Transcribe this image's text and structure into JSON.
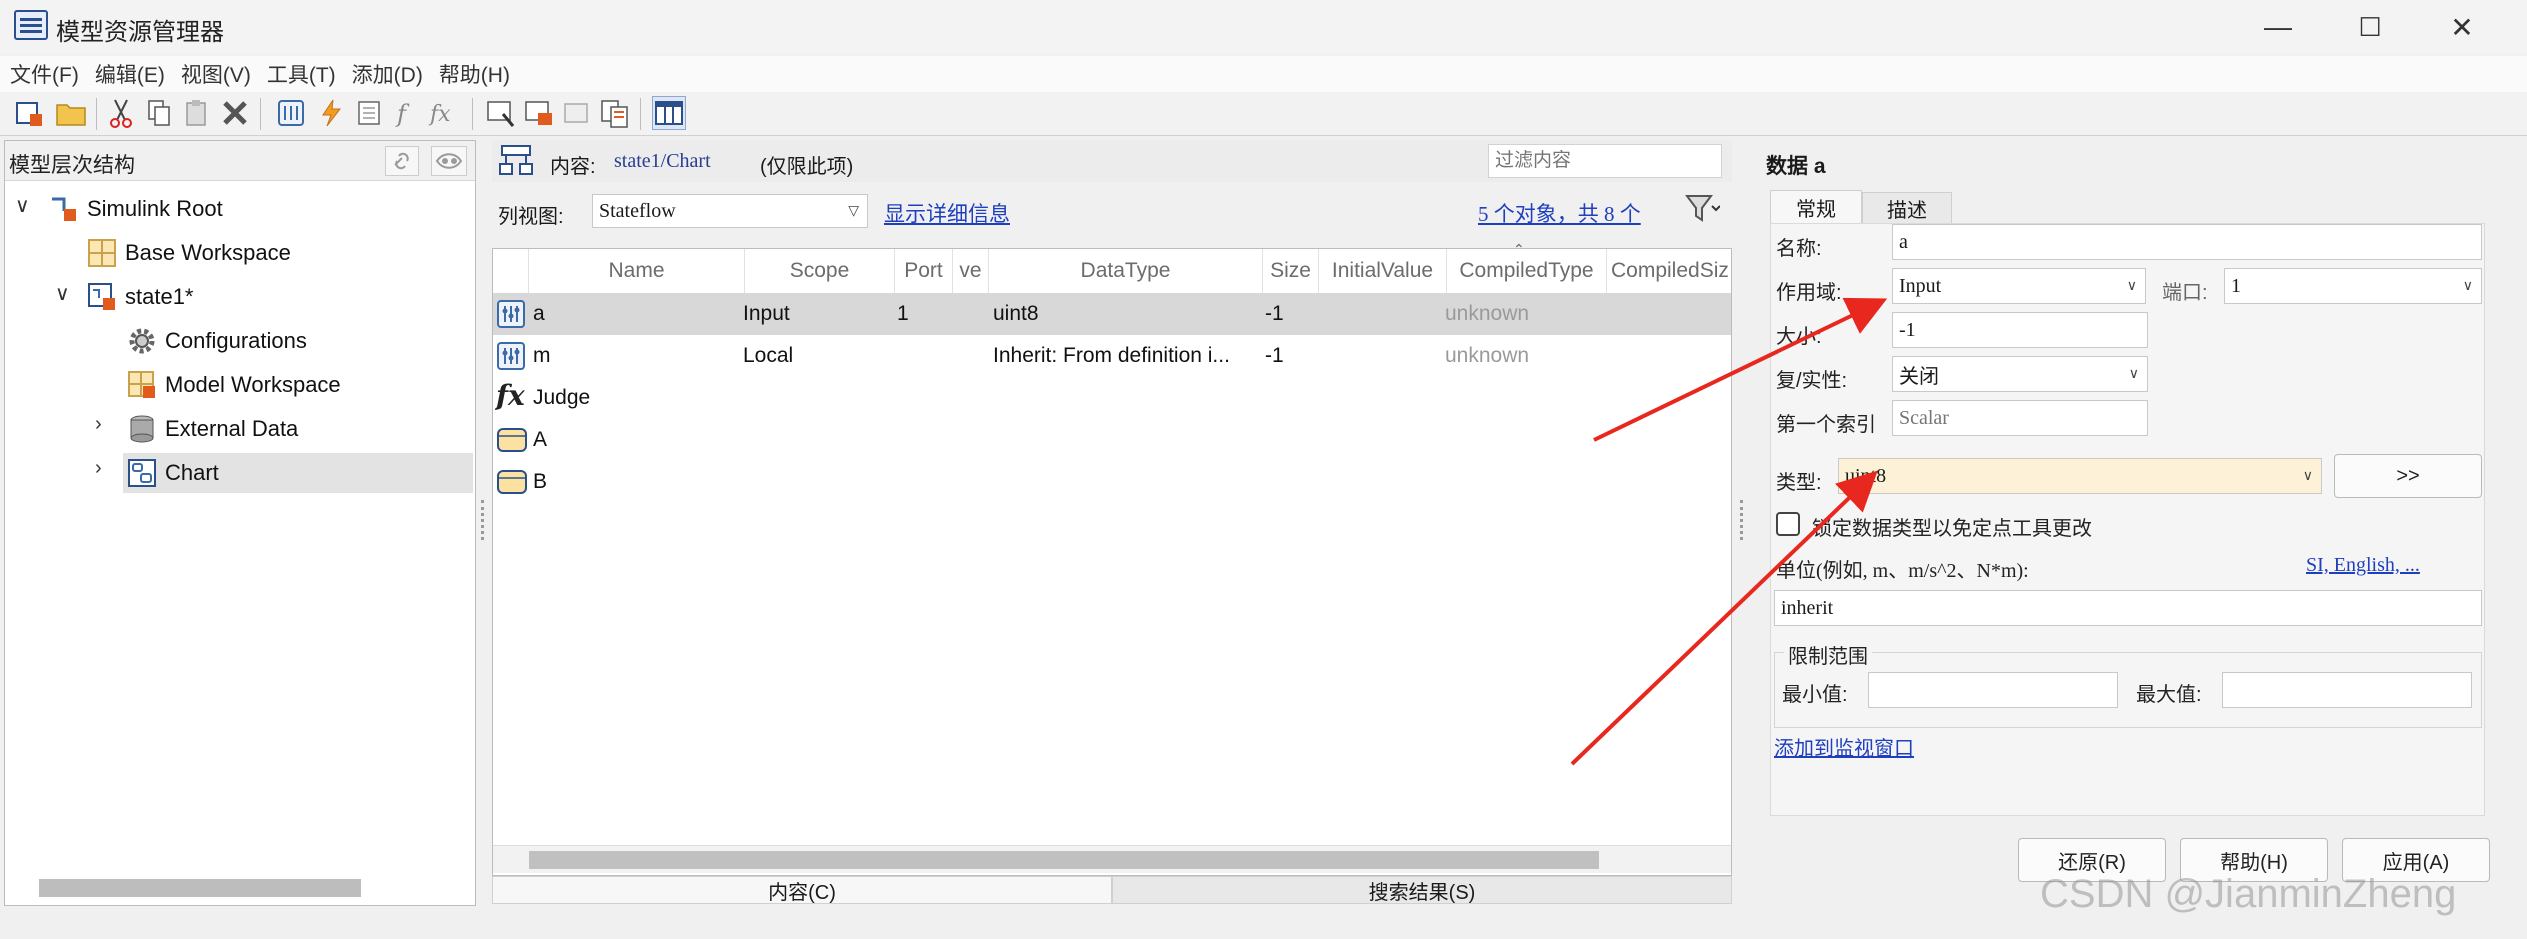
{
  "window": {
    "title": "模型资源管理器",
    "minimize": "—",
    "maximize": "☐",
    "close": "✕"
  },
  "menu": [
    "文件(F)",
    "编辑(E)",
    "视图(V)",
    "工具(T)",
    "添加(D)",
    "帮助(H)"
  ],
  "tree": {
    "header": "模型层次结构",
    "items": [
      {
        "label": "Simulink Root",
        "icon": "simulink-root-icon"
      },
      {
        "label": "Base Workspace",
        "icon": "workspace-icon"
      },
      {
        "label": "state1*",
        "icon": "model-icon"
      },
      {
        "label": "Configurations",
        "icon": "gear-icon"
      },
      {
        "label": "Model Workspace",
        "icon": "model-workspace-icon"
      },
      {
        "label": "External Data",
        "icon": "database-icon"
      },
      {
        "label": "Chart",
        "icon": "chart-icon"
      }
    ]
  },
  "content": {
    "label": "内容:",
    "path": "state1/Chart",
    "scope_note": "(仅限此项)",
    "filter_placeholder": "过滤内容",
    "column_view_label": "列视图:",
    "column_view_value": "Stateflow",
    "show_details": "显示详细信息",
    "object_count": "5 个对象，共 8 个",
    "columns": [
      "Name",
      "Scope",
      "Port",
      "ve",
      "DataType",
      "Size",
      "InitialValue",
      "CompiledType",
      "CompiledSiz"
    ],
    "rows": [
      {
        "name": "a",
        "scope": "Input",
        "port": "1",
        "datatype": "uint8",
        "size": "-1",
        "initial": "",
        "compiled": "unknown"
      },
      {
        "name": "m",
        "scope": "Local",
        "port": "",
        "datatype": "Inherit: From definition i...",
        "size": "-1",
        "initial": "",
        "compiled": "unknown"
      },
      {
        "name": "Judge",
        "scope": "",
        "port": "",
        "datatype": "",
        "size": "",
        "initial": "",
        "compiled": ""
      },
      {
        "name": "A",
        "scope": "",
        "port": "",
        "datatype": "",
        "size": "",
        "initial": "",
        "compiled": ""
      },
      {
        "name": "B",
        "scope": "",
        "port": "",
        "datatype": "",
        "size": "",
        "initial": "",
        "compiled": ""
      }
    ],
    "bottom_tabs": [
      "内容(C)",
      "搜索结果(S)"
    ]
  },
  "props": {
    "title": "数据 a",
    "tabs": [
      "常规",
      "描述"
    ],
    "name_label": "名称:",
    "name_value": "a",
    "scope_label": "作用域:",
    "scope_value": "Input",
    "port_label": "端口:",
    "port_value": "1",
    "size_label": "大小:",
    "size_value": "-1",
    "complexity_label": "复/实性:",
    "complexity_value": "关闭",
    "first_index_label": "第一个索引",
    "first_index_placeholder": "Scalar",
    "type_label": "类型:",
    "type_value": "uint8",
    "type_button": ">>",
    "lock_label": "锁定数据类型以免定点工具更改",
    "unit_label": "单位(例如, m、m/s^2、N*m):",
    "unit_link": "SI, English, ...",
    "unit_value": "inherit",
    "limits_label": "限制范围",
    "min_label": "最小值:",
    "max_label": "最大值:",
    "watch_link": "添加到监视窗口",
    "revert": "还原(R)",
    "help": "帮助(H)",
    "apply": "应用(A)"
  },
  "watermark": "CSDN @JianminZheng",
  "colors": {
    "annotation_arrow": "#e8281e",
    "link": "#1f3fbf",
    "type_bg": "#fdf2d8"
  }
}
